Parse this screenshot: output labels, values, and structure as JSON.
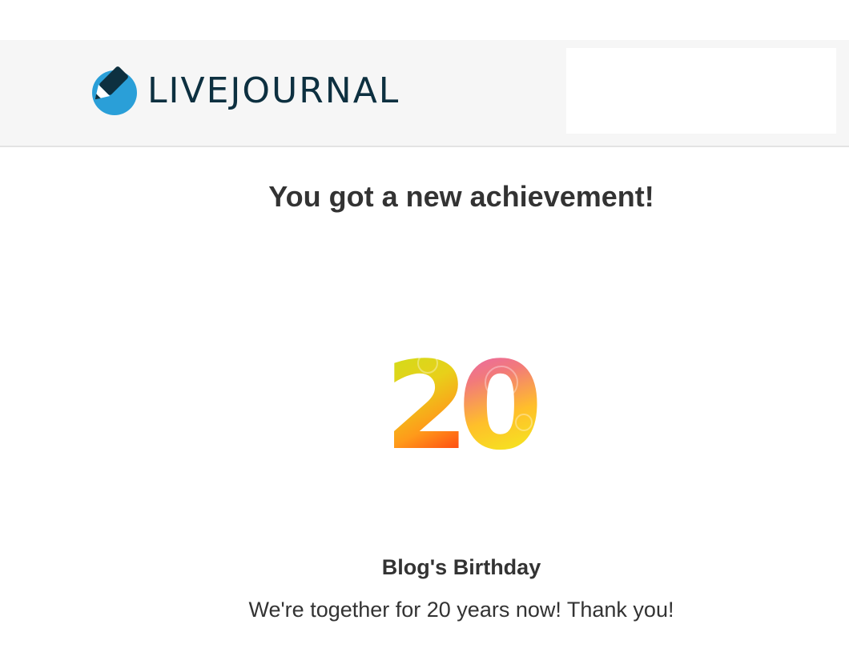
{
  "header": {
    "brand": "LIVEJOURNAL",
    "brand_color": "#0d3040",
    "logo_icon": "pencil-circle-icon",
    "logo_color": "#2a9fd8"
  },
  "main": {
    "title": "You got a new achievement!",
    "badge": {
      "icon": "twenty-badge-icon",
      "text": "20"
    },
    "achievement_name": "Blog's Birthday",
    "achievement_description": "We're together for 20 years now! Thank you!"
  }
}
